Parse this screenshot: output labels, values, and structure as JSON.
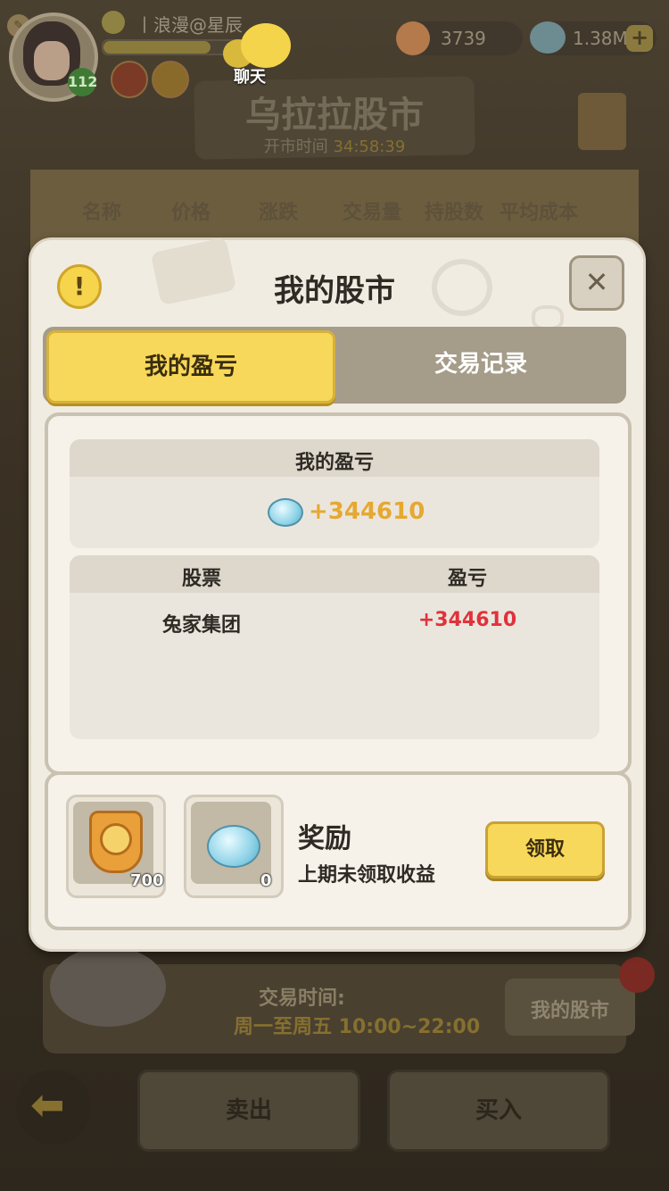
{
  "topbar": {
    "player_name": "丨浪漫@星辰",
    "level": "112",
    "chat_label": "聊天",
    "currency1": "3739",
    "currency2": "1.38M",
    "plus": "+"
  },
  "market": {
    "title": "乌拉拉股市",
    "open_time_label": "开市时间",
    "open_time_value": "34:58:39",
    "columns": [
      "名称",
      "价格",
      "涨跌",
      "交易量",
      "持股数",
      "平均成本"
    ]
  },
  "bottom": {
    "trade_time_label": "交易时间:",
    "trade_time_value": "周一至周五 10:00~22:00",
    "my_stock_button": "我的股市",
    "sell": "卖出",
    "buy": "买入",
    "back_arrow": "⬅"
  },
  "modal": {
    "title": "我的股市",
    "info": "!",
    "close": "✕",
    "tabs": [
      {
        "label": "我的盈亏",
        "active": true
      },
      {
        "label": "交易记录",
        "active": false
      }
    ],
    "profit_header": "我的盈亏",
    "profit_value": "+344610",
    "table": {
      "headers": [
        "股票",
        "盈亏"
      ],
      "rows": [
        {
          "stock": "兔家集团",
          "pnl": "+344610"
        }
      ]
    },
    "reward": {
      "items": [
        {
          "icon": "shield-badge-icon",
          "count": "700"
        },
        {
          "icon": "gem-icon",
          "count": "0"
        }
      ],
      "title": "奖励",
      "description": "上期未领取收益",
      "claim": "领取"
    }
  },
  "colors": {
    "accent_yellow": "#f7d85a",
    "profit_gold": "#e6a832",
    "profit_red": "#e0323c",
    "panel_bg": "#f1ece2"
  }
}
